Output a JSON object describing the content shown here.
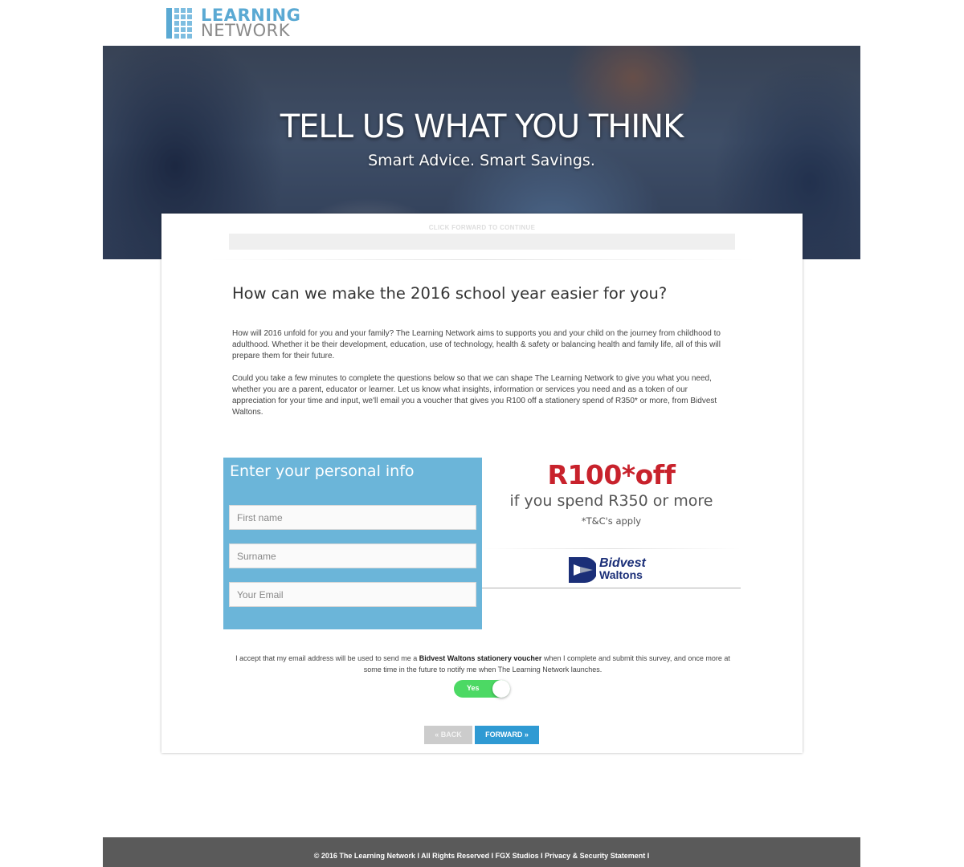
{
  "logo": {
    "line1": "LEARNING",
    "line2": "NETWORK",
    "icon": "learning-network-logo-icon"
  },
  "hero": {
    "title": "TELL US WHAT YOU THINK",
    "subtitle": "Smart Advice. Smart Savings."
  },
  "progress": {
    "label": "CLICK FORWARD TO CONTINUE",
    "fraction": 0.0
  },
  "main": {
    "question": "How can we make the 2016 school year easier for you?",
    "intro1": "How will 2016 unfold for you and your family? The Learning Network aims to supports you and your child on the journey from childhood to adulthood. Whether it be their development, education, use of technology, health & safety or balancing health and family life, all of this will prepare them for their future.",
    "intro2": "Could you take a few minutes to complete the questions below so that we can shape The Learning Network to give you what you need, whether you are a parent, educator or learner. Let us know what insights, information or services you need and as a token of our appreciation for your time and input, we'll email you a voucher that gives you R100 off a stationery spend of R350* or more, from Bidvest Waltons."
  },
  "form": {
    "title": "Enter your personal info",
    "first_name_placeholder": "First name",
    "surname_placeholder": "Surname",
    "email_placeholder": "Your Email"
  },
  "voucher": {
    "amount": "R100*off",
    "condition": "if you spend R350 or more",
    "terms": "*T&C's apply",
    "brand_line1": "Bidvest",
    "brand_line2": "Waltons"
  },
  "consent": {
    "text_before": "I accept that my email address will be used to send me a ",
    "text_bold": "Bidvest Waltons stationery voucher",
    "text_after": " when I complete and submit this survey, and once more at some time in the future to notify me when The Learning Network launches.",
    "toggle_label": "Yes",
    "toggle_on": true
  },
  "nav": {
    "back_label": "« BACK",
    "forward_label": "FORWARD »"
  },
  "footer": {
    "text": "© 2016 The Learning Network I All Rights Reserved I FGX Studios I Privacy & Security Statement I"
  },
  "colors": {
    "accent_blue": "#2f9ad3",
    "panel_blue": "#6bb5d9",
    "voucher_red": "#c8222c",
    "toggle_green": "#4cd964",
    "footer_gray": "#5a5a5a"
  }
}
